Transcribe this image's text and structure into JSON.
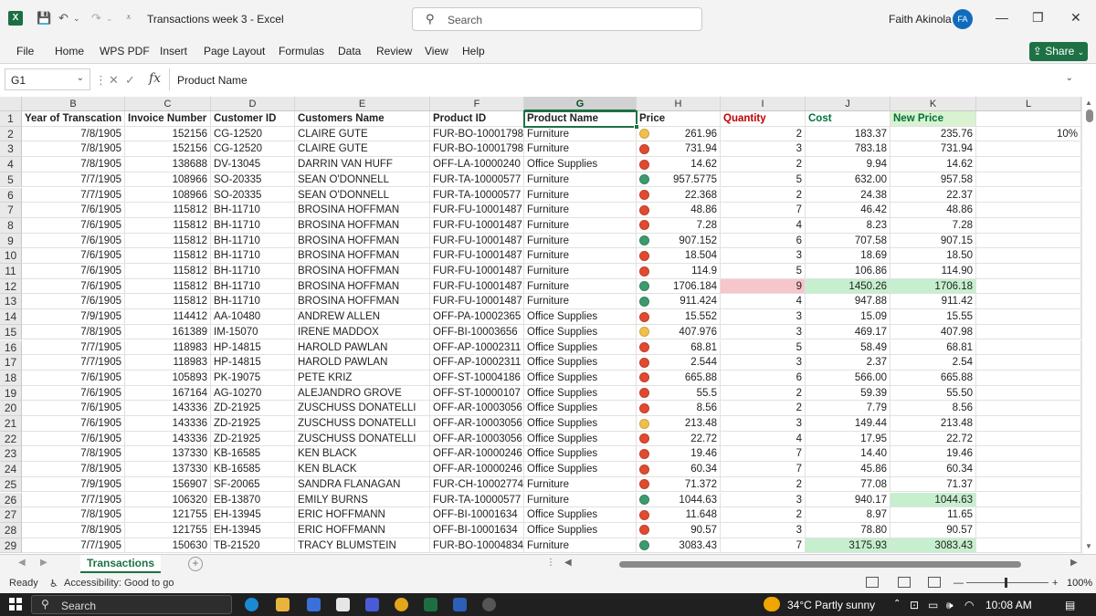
{
  "window": {
    "title": "Transactions week 3  -  Excel",
    "search_placeholder": "Search",
    "user_name": "Faith Akinola",
    "user_initials": "FA",
    "app_logo": "X"
  },
  "menu": [
    "File",
    "Home",
    "WPS PDF",
    "Insert",
    "Page Layout",
    "Formulas",
    "Data",
    "Review",
    "View",
    "Help"
  ],
  "share_label": "Share",
  "formula_bar": {
    "name_box": "G1",
    "fx": "fx",
    "formula": "Product Name"
  },
  "columns": [
    "B",
    "C",
    "D",
    "E",
    "F",
    "G",
    "H",
    "I",
    "J",
    "K",
    "L"
  ],
  "selected_column": "G",
  "row_numbers": [
    "1",
    "2",
    "3",
    "4",
    "5",
    "6",
    "7",
    "8",
    "9",
    "10",
    "11",
    "12",
    "13",
    "14",
    "15",
    "16",
    "17",
    "18",
    "19",
    "20",
    "21",
    "22",
    "23",
    "24",
    "25",
    "26",
    "27",
    "28",
    "29"
  ],
  "headers": {
    "year": "Year of Transcation",
    "invoice": "Invoice Number",
    "customer_id": "Customer ID",
    "customer_name": "Customers Name",
    "product_id": "Product ID",
    "product_name": "Product Name",
    "price": "Price",
    "quantity": "Quantity",
    "cost": "Cost",
    "new_price": "New Price"
  },
  "extra_cell_L2": "10%",
  "rows": [
    {
      "year": "7/8/1905",
      "invoice": "152156",
      "customer_id": "CG-12520",
      "customer_name": "CLAIRE  GUTE",
      "product_id": "FUR-BO-10001798",
      "product_name": "Furniture",
      "indicator": "yellow",
      "price": "261.96",
      "quantity": "2",
      "cost": "183.37",
      "new_price": "235.76"
    },
    {
      "year": "7/8/1905",
      "invoice": "152156",
      "customer_id": "CG-12520",
      "customer_name": "CLAIRE  GUTE",
      "product_id": "FUR-BO-10001798",
      "product_name": "Furniture",
      "indicator": "red",
      "price": "731.94",
      "quantity": "3",
      "cost": "783.18",
      "new_price": "731.94"
    },
    {
      "year": "7/8/1905",
      "invoice": "138688",
      "customer_id": "DV-13045",
      "customer_name": "DARRIN  VAN HUFF",
      "product_id": "OFF-LA-10000240",
      "product_name": "Office Supplies",
      "indicator": "red",
      "price": "14.62",
      "quantity": "2",
      "cost": "9.94",
      "new_price": "14.62"
    },
    {
      "year": "7/7/1905",
      "invoice": "108966",
      "customer_id": "SO-20335",
      "customer_name": "SEAN  O'DONNELL",
      "product_id": "FUR-TA-10000577",
      "product_name": "Furniture",
      "indicator": "green",
      "price": "957.5775",
      "quantity": "5",
      "cost": "632.00",
      "new_price": "957.58"
    },
    {
      "year": "7/7/1905",
      "invoice": "108966",
      "customer_id": "SO-20335",
      "customer_name": "SEAN  O'DONNELL",
      "product_id": "FUR-TA-10000577",
      "product_name": "Furniture",
      "indicator": "red",
      "price": "22.368",
      "quantity": "2",
      "cost": "24.38",
      "new_price": "22.37"
    },
    {
      "year": "7/6/1905",
      "invoice": "115812",
      "customer_id": "BH-11710",
      "customer_name": "BROSINA  HOFFMAN",
      "product_id": "FUR-FU-10001487",
      "product_name": "Furniture",
      "indicator": "red",
      "price": "48.86",
      "quantity": "7",
      "cost": "46.42",
      "new_price": "48.86"
    },
    {
      "year": "7/6/1905",
      "invoice": "115812",
      "customer_id": "BH-11710",
      "customer_name": "BROSINA  HOFFMAN",
      "product_id": "FUR-FU-10001487",
      "product_name": "Furniture",
      "indicator": "red",
      "price": "7.28",
      "quantity": "4",
      "cost": "8.23",
      "new_price": "7.28"
    },
    {
      "year": "7/6/1905",
      "invoice": "115812",
      "customer_id": "BH-11710",
      "customer_name": "BROSINA  HOFFMAN",
      "product_id": "FUR-FU-10001487",
      "product_name": "Furniture",
      "indicator": "green",
      "price": "907.152",
      "quantity": "6",
      "cost": "707.58",
      "new_price": "907.15"
    },
    {
      "year": "7/6/1905",
      "invoice": "115812",
      "customer_id": "BH-11710",
      "customer_name": "BROSINA  HOFFMAN",
      "product_id": "FUR-FU-10001487",
      "product_name": "Furniture",
      "indicator": "red",
      "price": "18.504",
      "quantity": "3",
      "cost": "18.69",
      "new_price": "18.50"
    },
    {
      "year": "7/6/1905",
      "invoice": "115812",
      "customer_id": "BH-11710",
      "customer_name": "BROSINA  HOFFMAN",
      "product_id": "FUR-FU-10001487",
      "product_name": "Furniture",
      "indicator": "red",
      "price": "114.9",
      "quantity": "5",
      "cost": "106.86",
      "new_price": "114.90"
    },
    {
      "year": "7/6/1905",
      "invoice": "115812",
      "customer_id": "BH-11710",
      "customer_name": "BROSINA  HOFFMAN",
      "product_id": "FUR-FU-10001487",
      "product_name": "Furniture",
      "indicator": "green",
      "price": "1706.184",
      "quantity": "9",
      "cost": "1450.26",
      "new_price": "1706.18",
      "hl_qty": "pink",
      "hl_cost": "green",
      "hl_new": "green"
    },
    {
      "year": "7/6/1905",
      "invoice": "115812",
      "customer_id": "BH-11710",
      "customer_name": "BROSINA  HOFFMAN",
      "product_id": "FUR-FU-10001487",
      "product_name": "Furniture",
      "indicator": "green",
      "price": "911.424",
      "quantity": "4",
      "cost": "947.88",
      "new_price": "911.42"
    },
    {
      "year": "7/9/1905",
      "invoice": "114412",
      "customer_id": "AA-10480",
      "customer_name": "ANDREW  ALLEN",
      "product_id": "OFF-PA-10002365",
      "product_name": "Office Supplies",
      "indicator": "red",
      "price": "15.552",
      "quantity": "3",
      "cost": "15.09",
      "new_price": "15.55"
    },
    {
      "year": "7/8/1905",
      "invoice": "161389",
      "customer_id": "IM-15070",
      "customer_name": "IRENE  MADDOX",
      "product_id": "OFF-BI-10003656",
      "product_name": "Office Supplies",
      "indicator": "yellow",
      "price": "407.976",
      "quantity": "3",
      "cost": "469.17",
      "new_price": "407.98"
    },
    {
      "year": "7/7/1905",
      "invoice": "118983",
      "customer_id": "HP-14815",
      "customer_name": "HAROLD  PAWLAN",
      "product_id": "OFF-AP-10002311",
      "product_name": "Office Supplies",
      "indicator": "red",
      "price": "68.81",
      "quantity": "5",
      "cost": "58.49",
      "new_price": "68.81"
    },
    {
      "year": "7/7/1905",
      "invoice": "118983",
      "customer_id": "HP-14815",
      "customer_name": "HAROLD  PAWLAN",
      "product_id": "OFF-AP-10002311",
      "product_name": "Office Supplies",
      "indicator": "red",
      "price": "2.544",
      "quantity": "3",
      "cost": "2.37",
      "new_price": "2.54"
    },
    {
      "year": "7/6/1905",
      "invoice": "105893",
      "customer_id": "PK-19075",
      "customer_name": "PETE  KRIZ",
      "product_id": "OFF-ST-10004186",
      "product_name": "Office Supplies",
      "indicator": "red",
      "price": "665.88",
      "quantity": "6",
      "cost": "566.00",
      "new_price": "665.88"
    },
    {
      "year": "7/6/1905",
      "invoice": "167164",
      "customer_id": "AG-10270",
      "customer_name": "ALEJANDRO  GROVE",
      "product_id": "OFF-ST-10000107",
      "product_name": "Office Supplies",
      "indicator": "red",
      "price": "55.5",
      "quantity": "2",
      "cost": "59.39",
      "new_price": "55.50"
    },
    {
      "year": "7/6/1905",
      "invoice": "143336",
      "customer_id": "ZD-21925",
      "customer_name": "ZUSCHUSS  DONATELLI",
      "product_id": "OFF-AR-10003056",
      "product_name": "Office Supplies",
      "indicator": "red",
      "price": "8.56",
      "quantity": "2",
      "cost": "7.79",
      "new_price": "8.56"
    },
    {
      "year": "7/6/1905",
      "invoice": "143336",
      "customer_id": "ZD-21925",
      "customer_name": "ZUSCHUSS  DONATELLI",
      "product_id": "OFF-AR-10003056",
      "product_name": "Office Supplies",
      "indicator": "yellow",
      "price": "213.48",
      "quantity": "3",
      "cost": "149.44",
      "new_price": "213.48"
    },
    {
      "year": "7/6/1905",
      "invoice": "143336",
      "customer_id": "ZD-21925",
      "customer_name": "ZUSCHUSS  DONATELLI",
      "product_id": "OFF-AR-10003056",
      "product_name": "Office Supplies",
      "indicator": "red",
      "price": "22.72",
      "quantity": "4",
      "cost": "17.95",
      "new_price": "22.72"
    },
    {
      "year": "7/8/1905",
      "invoice": "137330",
      "customer_id": "KB-16585",
      "customer_name": "KEN  BLACK",
      "product_id": "OFF-AR-10000246",
      "product_name": "Office Supplies",
      "indicator": "red",
      "price": "19.46",
      "quantity": "7",
      "cost": "14.40",
      "new_price": "19.46"
    },
    {
      "year": "7/8/1905",
      "invoice": "137330",
      "customer_id": "KB-16585",
      "customer_name": "KEN  BLACK",
      "product_id": "OFF-AR-10000246",
      "product_name": "Office Supplies",
      "indicator": "red",
      "price": "60.34",
      "quantity": "7",
      "cost": "45.86",
      "new_price": "60.34"
    },
    {
      "year": "7/9/1905",
      "invoice": "156907",
      "customer_id": "SF-20065",
      "customer_name": "SANDRA  FLANAGAN",
      "product_id": "FUR-CH-10002774",
      "product_name": "Furniture",
      "indicator": "red",
      "price": "71.372",
      "quantity": "2",
      "cost": "77.08",
      "new_price": "71.37"
    },
    {
      "year": "7/7/1905",
      "invoice": "106320",
      "customer_id": "EB-13870",
      "customer_name": "EMILY  BURNS",
      "product_id": "FUR-TA-10000577",
      "product_name": "Furniture",
      "indicator": "green",
      "price": "1044.63",
      "quantity": "3",
      "cost": "940.17",
      "new_price": "1044.63",
      "hl_new": "green"
    },
    {
      "year": "7/8/1905",
      "invoice": "121755",
      "customer_id": "EH-13945",
      "customer_name": "ERIC  HOFFMANN",
      "product_id": "OFF-BI-10001634",
      "product_name": "Office Supplies",
      "indicator": "red",
      "price": "11.648",
      "quantity": "2",
      "cost": "8.97",
      "new_price": "11.65"
    },
    {
      "year": "7/8/1905",
      "invoice": "121755",
      "customer_id": "EH-13945",
      "customer_name": "ERIC  HOFFMANN",
      "product_id": "OFF-BI-10001634",
      "product_name": "Office Supplies",
      "indicator": "red",
      "price": "90.57",
      "quantity": "3",
      "cost": "78.80",
      "new_price": "90.57"
    },
    {
      "year": "7/7/1905",
      "invoice": "150630",
      "customer_id": "TB-21520",
      "customer_name": "TRACY  BLUMSTEIN",
      "product_id": "FUR-BO-10004834",
      "product_name": "Furniture",
      "indicator": "green",
      "price": "3083.43",
      "quantity": "7",
      "cost": "3175.93",
      "new_price": "3083.43",
      "hl_cost": "green",
      "hl_new": "green"
    }
  ],
  "colors": {
    "excel_green": "#1e7145",
    "quantity_header": "#c00000",
    "cost_header": "#00703c",
    "new_price_header_bg": "#d9f2d0",
    "indicator_red": "#e04b2f",
    "indicator_yellow": "#f2c04a",
    "indicator_green": "#3d9a6e",
    "highlight_pink": "#f7c6cc",
    "highlight_green": "#c6efce"
  },
  "sheet_tab": "Transactions",
  "status": {
    "ready": "Ready",
    "accessibility": "Accessibility: Good to go",
    "zoom": "100%"
  },
  "taskbar": {
    "search": "Search",
    "weather": "34°C  Partly sunny",
    "time": "10:08 AM"
  }
}
